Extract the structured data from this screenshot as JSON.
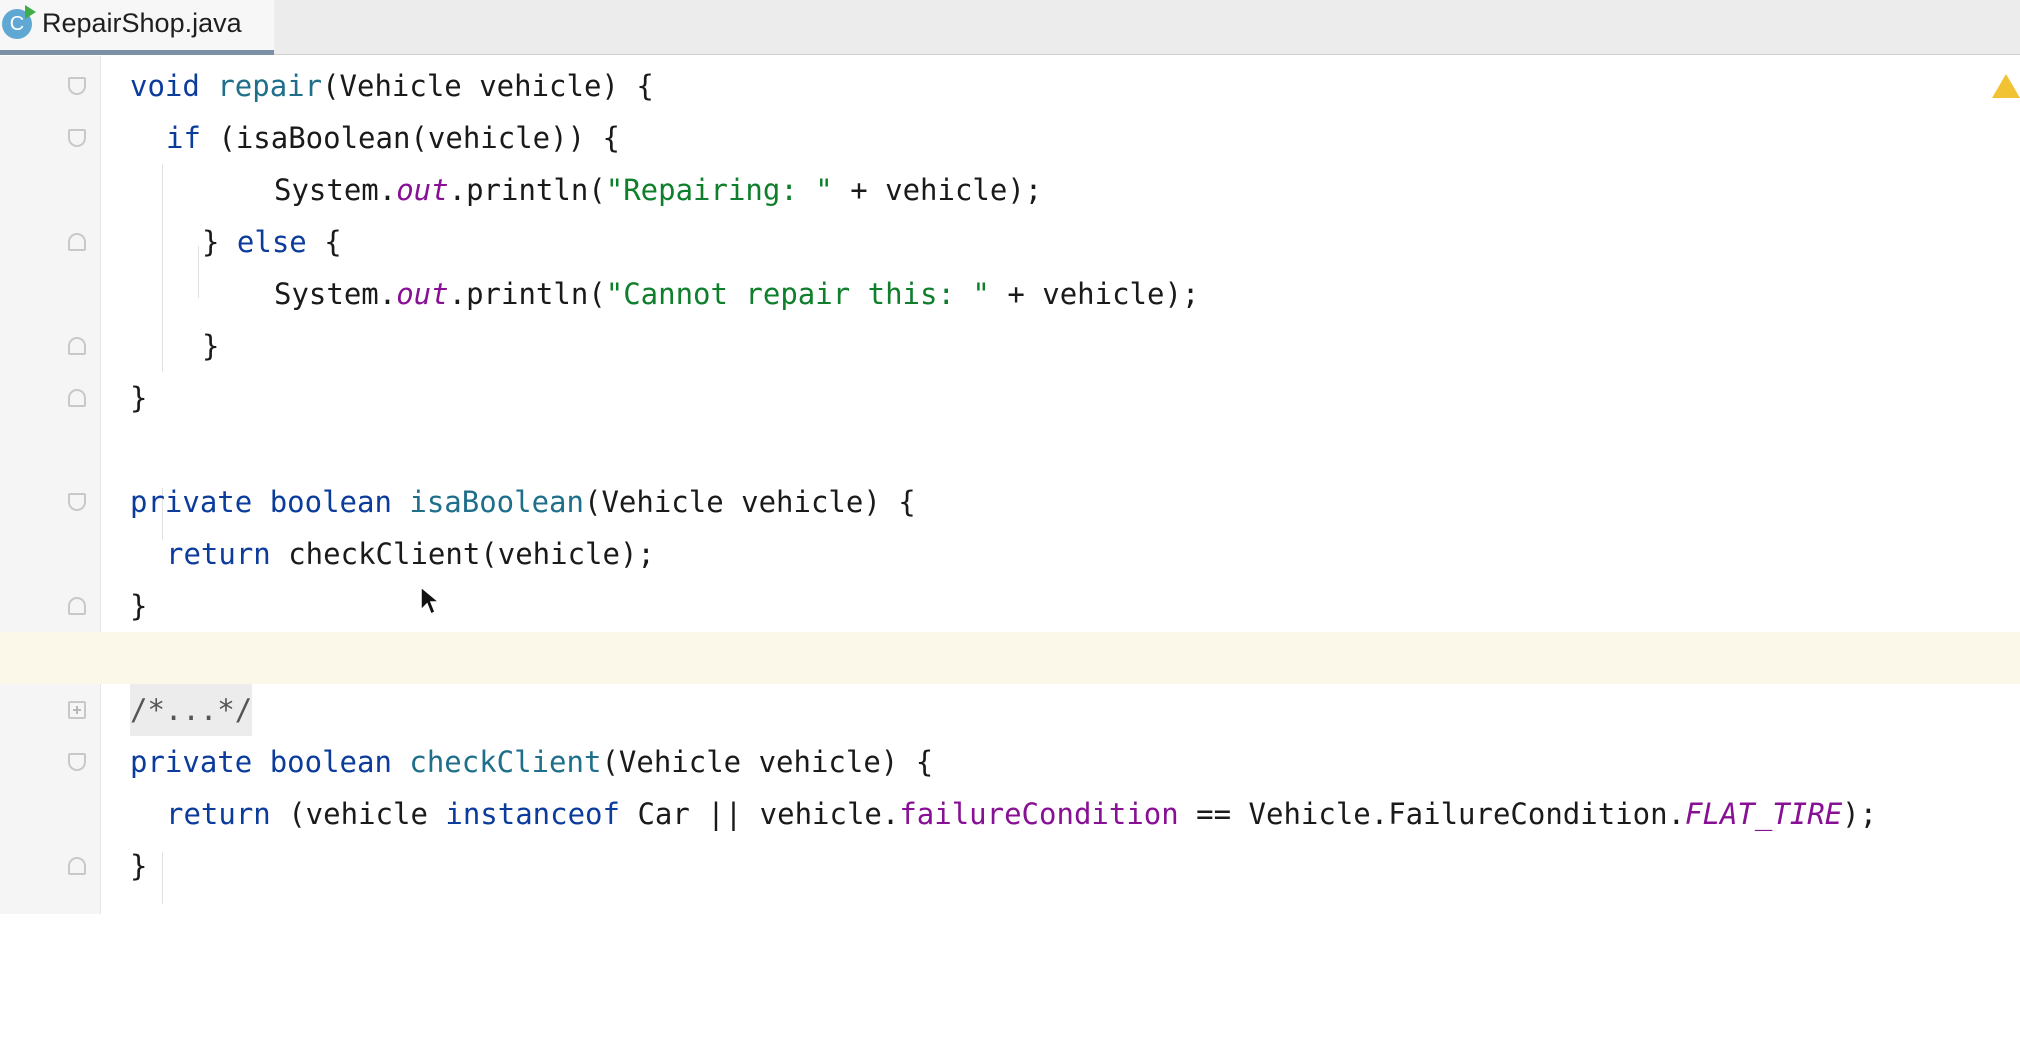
{
  "tab": {
    "icon_letter": "C",
    "filename": "RepairShop.java"
  },
  "icons": {
    "file_icon": "java-class-icon",
    "warning": "warning-icon",
    "fold": "fold-marker-icon",
    "pointer": "mouse-pointer-icon"
  },
  "colors": {
    "keyword": "#0b3c9c",
    "method": "#1f6f8b",
    "string": "#0f7f2c",
    "field": "#871094",
    "current_line": "#fbf8ea"
  },
  "code": {
    "l1": {
      "a": "void",
      "b": " ",
      "c": "repair",
      "d": "(Vehicle vehicle) {"
    },
    "l2": {
      "a": "if",
      "b": " (isaBoolean(vehicle)) {"
    },
    "l3": {
      "a": "System.",
      "b": "out",
      "c": ".println(",
      "d": "\"Repairing: \"",
      "e": " + vehicle);"
    },
    "l4": {
      "a": "} ",
      "b": "else",
      "c": " {"
    },
    "l5": {
      "a": "System.",
      "b": "out",
      "c": ".println(",
      "d": "\"Cannot repair this: \"",
      "e": " + vehicle);"
    },
    "l6": {
      "a": "}"
    },
    "l7": {
      "a": "}"
    },
    "l9": {
      "a": "private",
      "b": " ",
      "c": "boolean",
      "d": " ",
      "e": "isaBoolean",
      "f": "(Vehicle vehicle) {"
    },
    "l10": {
      "a": "return",
      "b": " checkClient(vehicle);"
    },
    "l11": {
      "a": "}"
    },
    "l13": {
      "a": "/*...*/"
    },
    "l14": {
      "a": "private",
      "b": " ",
      "c": "boolean",
      "d": " ",
      "e": "checkClient",
      "f": "(Vehicle vehicle) {"
    },
    "l15": {
      "a": "return",
      "b": " (vehicle ",
      "c": "instanceof",
      "d": " Car || vehicle.",
      "e": "failureCondition",
      "f": " == Vehicle.FailureCondition.",
      "g": "FLAT_TIRE",
      "h": ");"
    },
    "l16": {
      "a": "}"
    }
  }
}
